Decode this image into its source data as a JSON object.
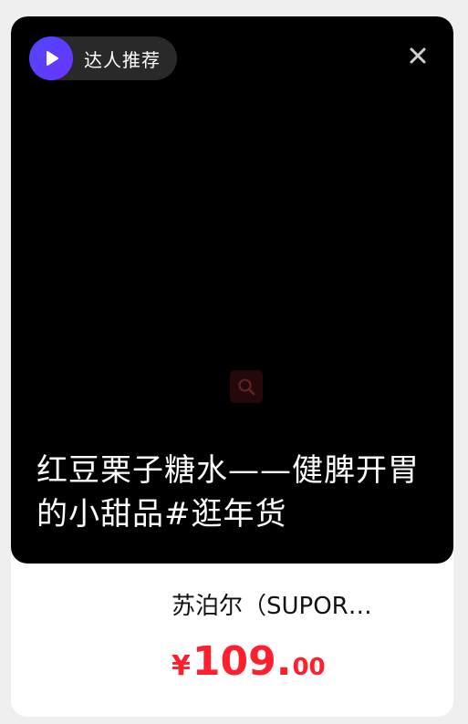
{
  "badge": {
    "label": "达人推荐",
    "icon": "play-icon",
    "color": "#4f46ff"
  },
  "close": {
    "icon": "close-icon"
  },
  "video": {
    "caption": "红豆栗子糖水——健脾开胃的小甜品#逛年货",
    "center_icon": "search-icon"
  },
  "product": {
    "title": "苏泊尔（SUPOR…",
    "price_currency": "¥",
    "price_integer": "109.",
    "price_decimal": "00",
    "price_color": "#ff1f2d"
  }
}
